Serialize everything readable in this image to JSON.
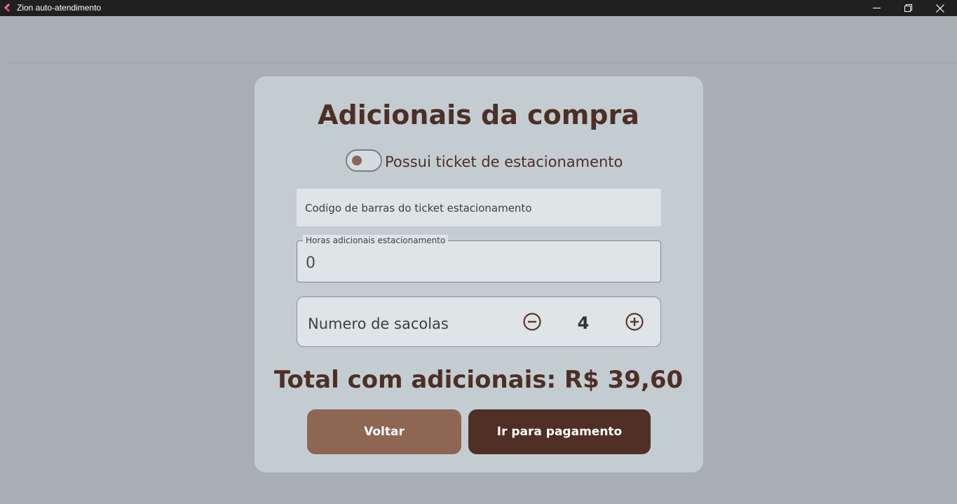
{
  "window": {
    "title": "Zion auto-atendimento",
    "icon": "app-logo-icon",
    "controls": [
      "minimize-icon",
      "restore-icon",
      "close-icon"
    ]
  },
  "page": {
    "title": "Adicionais da compra"
  },
  "parking_toggle": {
    "label": "Possui ticket de estacionamento",
    "checked": false
  },
  "barcode_field": {
    "label": "Codigo de barras do ticket estacionamento",
    "value": ""
  },
  "hours_field": {
    "label": "Horas adicionais estacionamento",
    "value": "0"
  },
  "bags": {
    "label": "Numero de sacolas",
    "count": "4",
    "decrement_icon": "minus-circle-icon",
    "increment_icon": "plus-circle-icon"
  },
  "total": {
    "text": "Total com adicionais: R$ 39,60"
  },
  "actions": {
    "back_label": "Voltar",
    "pay_label": "Ir para pagamento"
  },
  "colors": {
    "brand_dark": "#4f2f26",
    "brand_light": "#8d6654",
    "background": "#a7aeb4",
    "card": "#c3cdd1"
  }
}
